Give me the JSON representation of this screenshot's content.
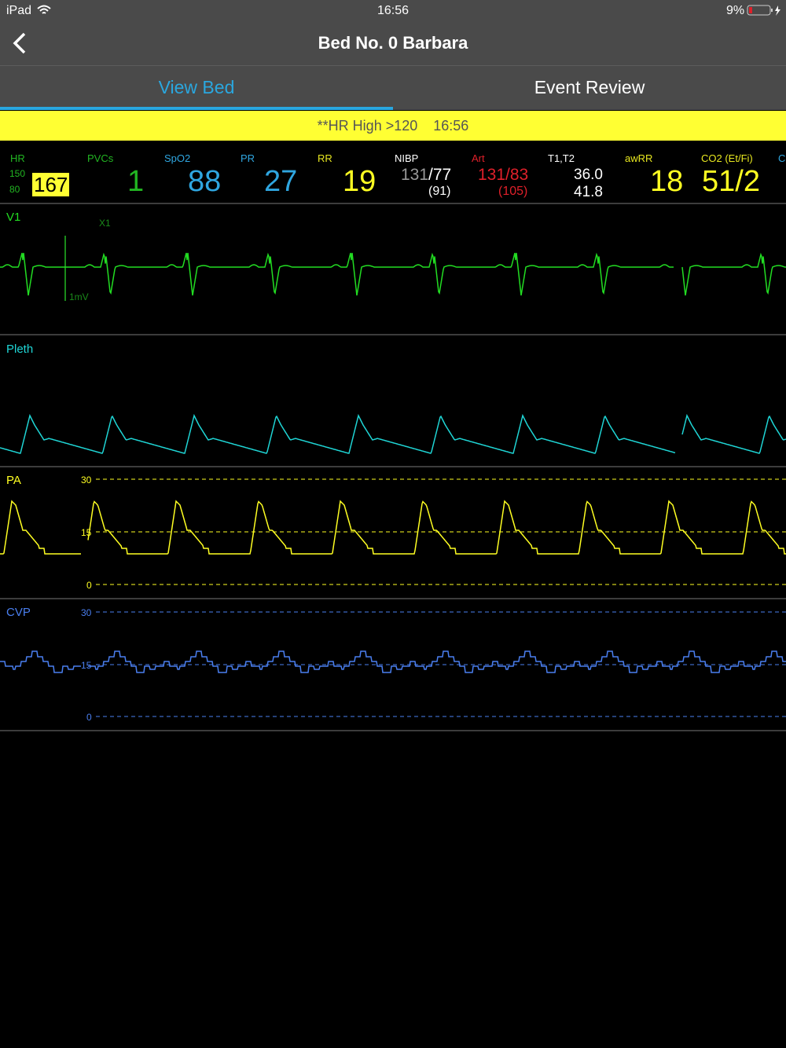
{
  "status_bar": {
    "device": "iPad",
    "time": "16:56",
    "battery": "9%"
  },
  "nav": {
    "title": "Bed No. 0 Barbara"
  },
  "tabs": [
    {
      "label": "View Bed",
      "active": true
    },
    {
      "label": "Event Review",
      "active": false
    }
  ],
  "alarm": {
    "text": "**HR High >120",
    "time": "16:56"
  },
  "vitals": {
    "hr": {
      "label": "HR",
      "high": "150",
      "low": "80",
      "value": "167"
    },
    "pvcs": {
      "label": "PVCs",
      "value": "1"
    },
    "spo2": {
      "label": "SpO2",
      "value": "88"
    },
    "pr": {
      "label": "PR",
      "value": "27"
    },
    "rr": {
      "label": "RR",
      "value": "19"
    },
    "nibp": {
      "label": "NIBP",
      "sys": "131",
      "dia": "/77",
      "mean": "(91)"
    },
    "art": {
      "label": "Art",
      "value": "131/83",
      "mean": "(105)"
    },
    "temp": {
      "label": "T1,T2",
      "t1": "36.0",
      "t2": "41.8"
    },
    "awrr": {
      "label": "awRR",
      "value": "18"
    },
    "co2": {
      "label": "CO2 (Et/Fi)",
      "value": "51/2"
    },
    "cut": {
      "label": "C"
    }
  },
  "waves": {
    "ecg": {
      "label": "V1",
      "gain": "X1",
      "cal": "1mV"
    },
    "pleth": {
      "label": "Pleth"
    },
    "pa": {
      "label": "PA",
      "scale": [
        "30",
        "15",
        "0"
      ]
    },
    "cvp": {
      "label": "CVP",
      "scale": [
        "30",
        "15",
        "0"
      ]
    }
  },
  "colors": {
    "green": "#22dd22",
    "cyan": "#1fd6d6",
    "blue": "#2fa6e0",
    "yellow": "#ffff22",
    "red": "#e0202a",
    "cvp": "#4a7ff0"
  }
}
